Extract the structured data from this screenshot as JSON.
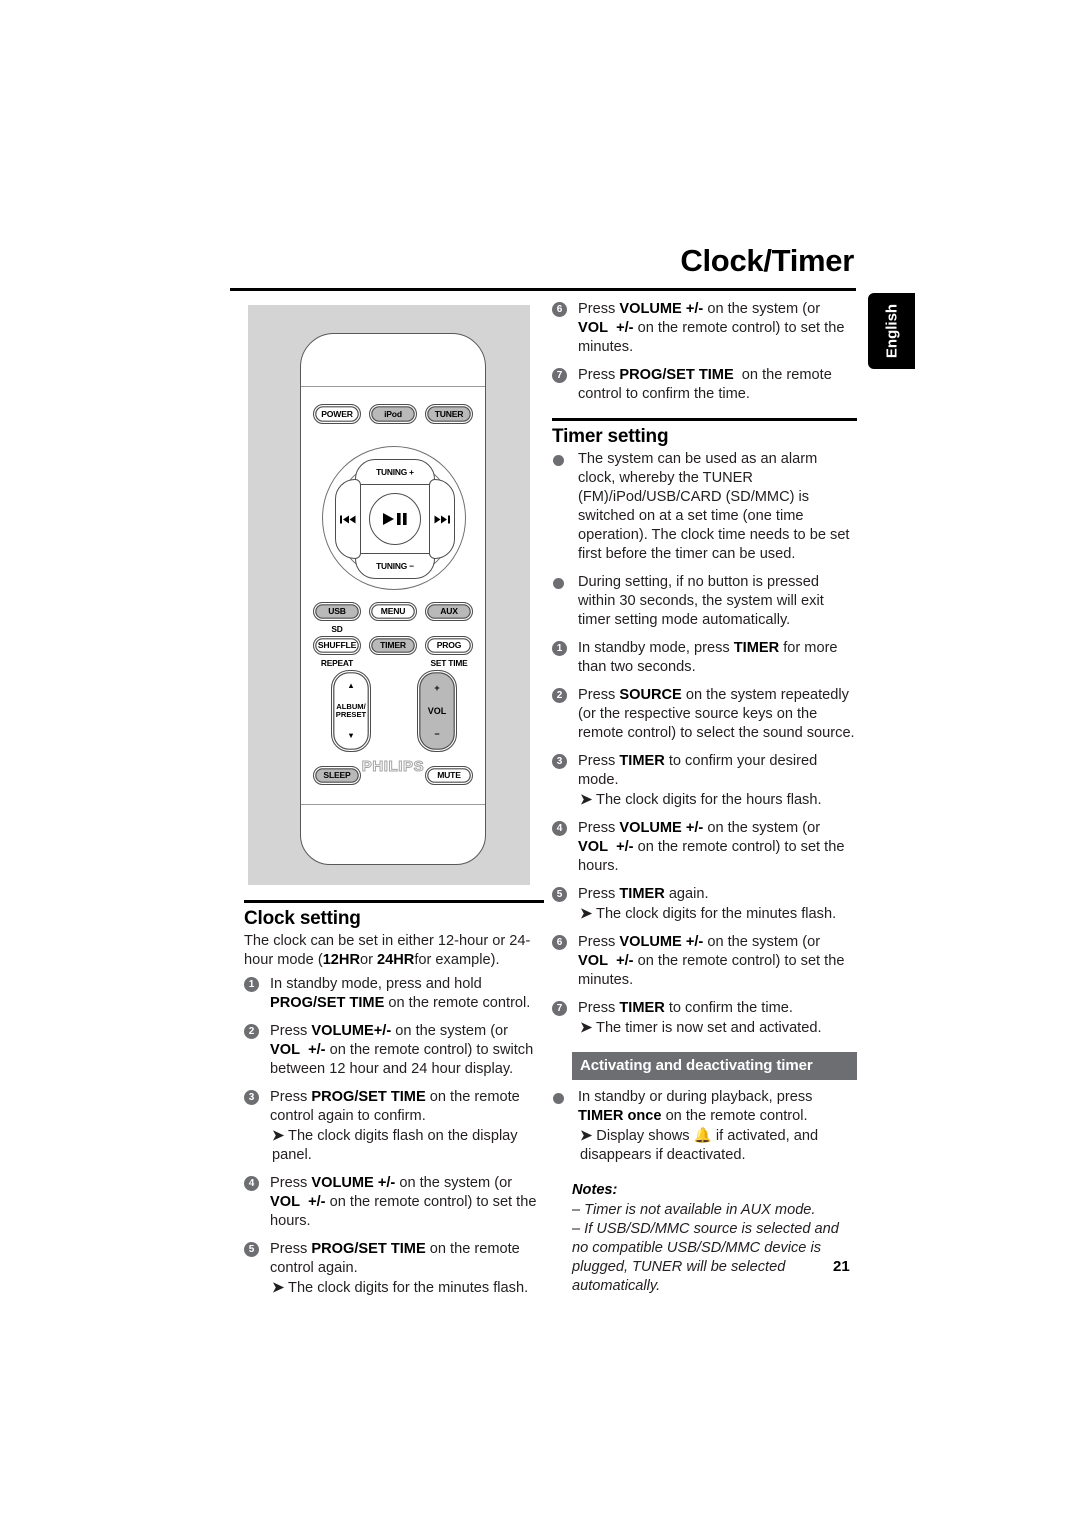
{
  "page": {
    "title": "Clock/Timer",
    "language_tab": "English",
    "page_number": "21"
  },
  "remote": {
    "brand": "PHILIPS",
    "keys": {
      "power": "POWER",
      "ipod": "iPod",
      "tuner": "TUNER",
      "tuning_plus": "TUNING +",
      "tuning_minus": "TUNING −",
      "prev": "⏮",
      "next": "⏭",
      "play_pause": "▶❘❘",
      "usb": "USB",
      "menu": "MENU",
      "aux": "AUX",
      "sd": "SD",
      "shuffle": "SHUFFLE",
      "timer": "TIMER",
      "prog": "PROG",
      "repeat": "REPEAT",
      "set_time": "SET TIME",
      "album_preset": "ALBUM/\nPRESET",
      "up_arrow": "▲",
      "down_arrow": "▼",
      "vol": "VOL",
      "vol_plus": "+",
      "vol_minus": "−",
      "sleep": "SLEEP",
      "mute": "MUTE"
    }
  },
  "right_column": {
    "top_steps": [
      {
        "num": "6",
        "html": "Press <b>VOLUME +/-</b> on the system (or <b>VOL&nbsp; +/-</b> on the remote control) to set the minutes."
      },
      {
        "num": "7",
        "html": "Press <b>PROG/SET TIME</b>&nbsp; on the remote control to confirm the time."
      }
    ],
    "timer_setting": {
      "heading": "Timer setting",
      "bullets": [
        "The system can be used as an alarm clock, whereby the TUNER (FM)/iPod/USB/CARD (SD/MMC) is switched on at a set time (one time operation). The clock time needs to be set first before the timer can be used.",
        "During setting, if no button is pressed within 30 seconds, the system will exit timer setting mode automatically."
      ],
      "steps": [
        {
          "num": "1",
          "html": "In standby mode, press <b>TIMER</b> for more than two seconds.",
          "result": ""
        },
        {
          "num": "2",
          "html": "Press <b>SOURCE</b> on the system repeatedly (or the respective source keys on the remote control) to select the sound source.",
          "result": ""
        },
        {
          "num": "3",
          "html": "Press <b>TIMER</b> to confirm your desired mode.",
          "result": "The clock digits for the hours flash."
        },
        {
          "num": "4",
          "html": "Press <b>VOLUME +/-</b> on the system (or <b>VOL&nbsp; +/-</b> on the remote control) to set the hours.",
          "result": ""
        },
        {
          "num": "5",
          "html": "Press <b>TIMER</b> again.",
          "result": "The clock digits for the minutes flash."
        },
        {
          "num": "6",
          "html": "Press <b>VOLUME +/-</b> on the system (or <b>VOL&nbsp; +/-</b> on the remote control) to set the minutes.",
          "result": ""
        },
        {
          "num": "7",
          "html": "Press <b>TIMER</b> to confirm the time.",
          "result": "The timer is now set and activated."
        }
      ]
    },
    "activating": {
      "subheading": "Activating and deactivating timer",
      "bullet_html": "In standby or during playback, press <b>TIMER once</b> on the remote control.",
      "result_html": "Display shows 🔔 if activated, and disappears if deactivated."
    },
    "notes": {
      "title": "Notes:",
      "items": [
        "–  Timer is not available in  AUX mode.",
        "–  If USB/SD/MMC source is selected and no compatible USB/SD/MMC device is plugged, TUNER will be selected automatically."
      ]
    }
  },
  "left_column": {
    "clock_setting": {
      "heading": "Clock setting",
      "intro_html": "The clock can be set in either 12-hour or 24-hour mode (<b>12HR</b>or <b>24HR</b>for example).",
      "steps": [
        {
          "num": "1",
          "html": "In standby mode, press and hold <b>PROG/SET TIME</b> on the remote control.",
          "result": ""
        },
        {
          "num": "2",
          "html": "Press <b>VOLUME+/-</b> on the system (or <b>VOL&nbsp; +/-</b> on the remote control) to switch between 12 hour and 24 hour display.",
          "result": ""
        },
        {
          "num": "3",
          "html": "Press <b>PROG/SET TIME</b> on the remote control again to confirm.",
          "result": "The clock digits flash on the display panel."
        },
        {
          "num": "4",
          "html": "Press <b>VOLUME +/-</b> on the system (or <b>VOL&nbsp; +/-</b> on the remote control) to set the hours.",
          "result": ""
        },
        {
          "num": "5",
          "html": "Press <b>PROG/SET TIME</b> on the remote control again.",
          "result": "The clock digits for the minutes flash."
        }
      ]
    }
  }
}
